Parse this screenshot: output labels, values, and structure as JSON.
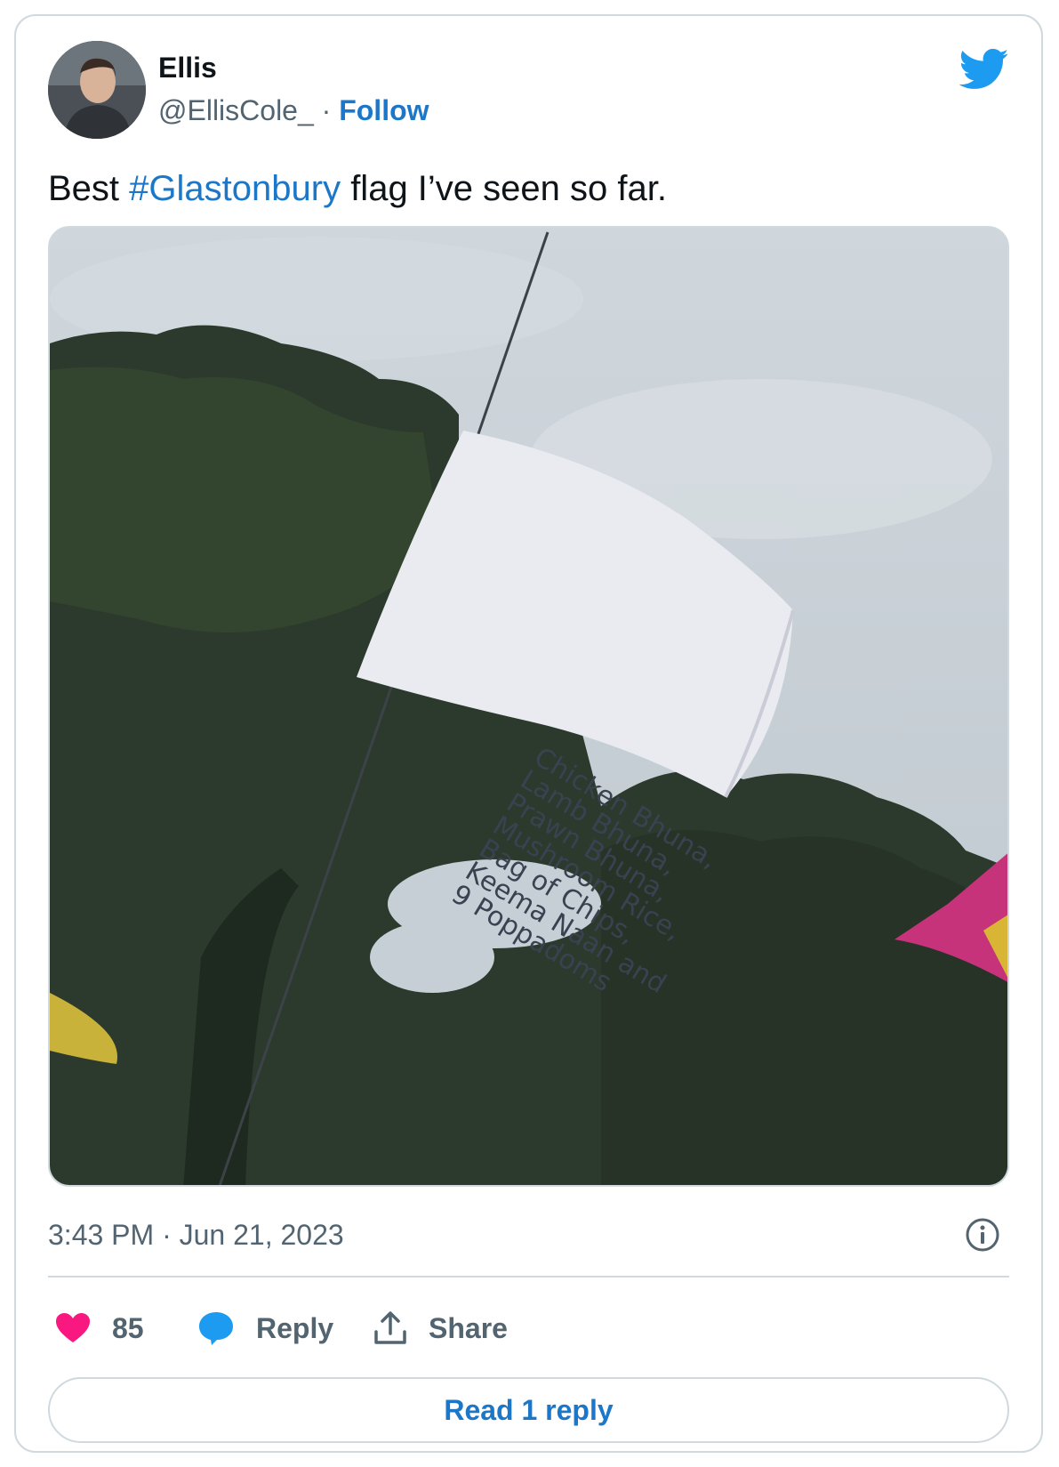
{
  "author": {
    "display_name": "Ellis",
    "handle": "@EllisCole_",
    "separator": " · ",
    "follow_label": "Follow"
  },
  "tweet": {
    "text_before": "Best ",
    "hashtag": "#Glastonbury",
    "text_after": " flag I’ve seen so far.",
    "timestamp": "3:43 PM · Jun 21, 2023"
  },
  "media": {
    "flag_lines": [
      "Chicken Bhuna,",
      "Lamb Bhuna,",
      "Prawn Bhuna,",
      "Mushroom Rice,",
      "Bag of Chips,",
      "Keema Naan and",
      "9 Poppadoms"
    ]
  },
  "actions": {
    "like_count": "85",
    "reply_label": "Reply",
    "share_label": "Share"
  },
  "read_reply_label": "Read 1 reply",
  "colors": {
    "link": "#1d77c9",
    "like": "#f91880",
    "reply": "#1d9bf0",
    "twitter": "#1d9bf0"
  }
}
